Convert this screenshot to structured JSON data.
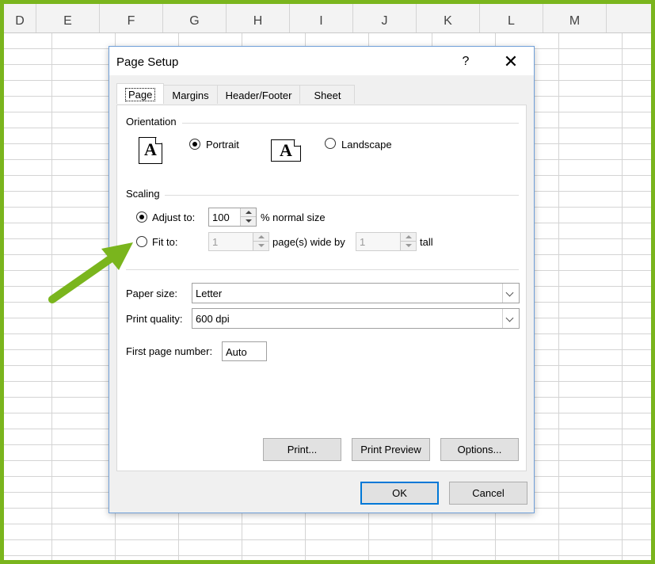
{
  "spreadsheet": {
    "columns": [
      "D",
      "E",
      "F",
      "G",
      "H",
      "I",
      "J",
      "K",
      "L",
      "M"
    ]
  },
  "dialog": {
    "title": "Page Setup",
    "help": "?",
    "close": "✕",
    "tabs": [
      {
        "label": "Page",
        "active": true
      },
      {
        "label": "Margins",
        "active": false
      },
      {
        "label": "Header/Footer",
        "active": false
      },
      {
        "label": "Sheet",
        "active": false
      }
    ],
    "orientation": {
      "label": "Orientation",
      "portrait_label": "Portrait",
      "portrait_icon": "A",
      "landscape_label": "Landscape",
      "landscape_icon": "A",
      "selected": "portrait"
    },
    "scaling": {
      "label": "Scaling",
      "adjust_to_label": "Adjust to:",
      "adjust_to_value": "100",
      "normal_size_suffix": "% normal size",
      "fit_to_label": "Fit to:",
      "fit_wide_value": "1",
      "pages_wide_by_label": "page(s) wide by",
      "fit_tall_value": "1",
      "tall_label": "tall",
      "selected": "adjust"
    },
    "paper_size": {
      "label": "Paper size:",
      "value": "Letter"
    },
    "print_quality": {
      "label": "Print quality:",
      "value": "600 dpi"
    },
    "first_page_number": {
      "label": "First page number:",
      "value": "Auto"
    },
    "buttons": {
      "print": "Print...",
      "print_preview": "Print Preview",
      "options": "Options...",
      "ok": "OK",
      "cancel": "Cancel"
    }
  },
  "annotation": {
    "arrow_color": "#7ab51d",
    "points_to": "fit-to-radio"
  },
  "colors": {
    "frame": "#7ab51d",
    "focus": "#0078d7"
  }
}
